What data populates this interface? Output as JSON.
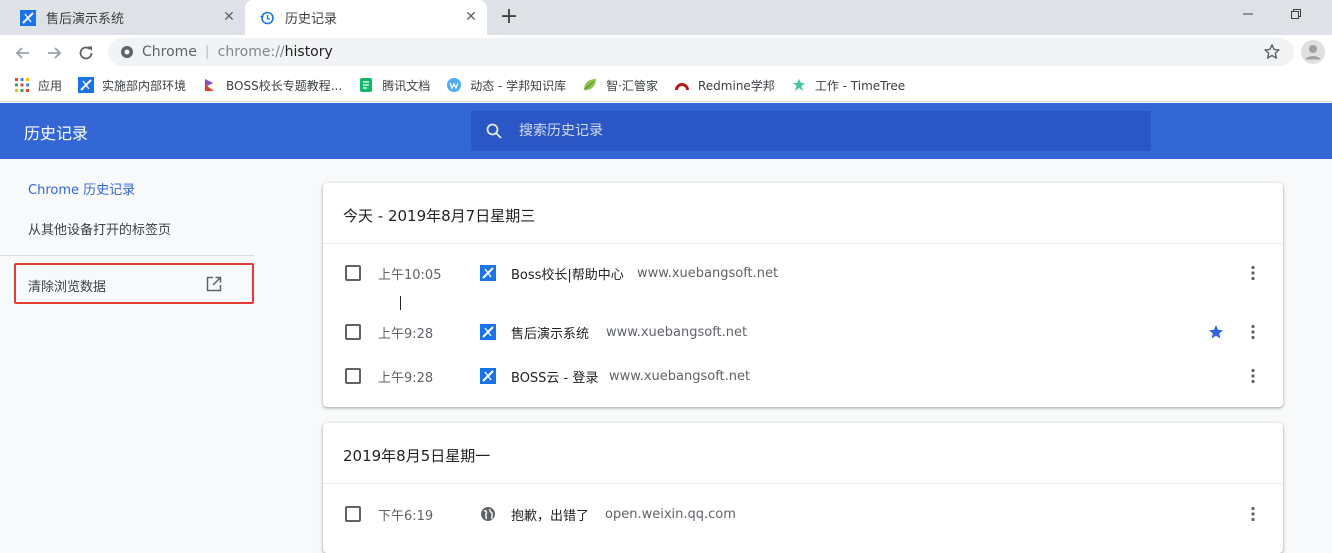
{
  "tabs": [
    {
      "title": "售后演示系统",
      "icon": "x-logo-icon",
      "close": "✕"
    },
    {
      "title": "历史记录",
      "icon": "history-icon",
      "close": "✕"
    }
  ],
  "new_tab_symbol": "+",
  "omnibox": {
    "chip": "Chrome",
    "separator": "|",
    "scheme": "chrome://",
    "path": "history"
  },
  "bookmarks": [
    {
      "label": "应用",
      "icon": "apps-grid-icon"
    },
    {
      "label": "实施部内部环境",
      "icon": "x-logo-icon"
    },
    {
      "label": "BOSS校长专题教程...",
      "icon": "boss-logo-icon"
    },
    {
      "label": "腾讯文档",
      "icon": "tencent-docs-icon"
    },
    {
      "label": "动态 - 学邦知识库",
      "icon": "wiki-icon"
    },
    {
      "label": "智·汇管家",
      "icon": "leaf-icon"
    },
    {
      "label": "Redmine学邦",
      "icon": "redmine-icon"
    },
    {
      "label": "工作 - TimeTree",
      "icon": "timetree-icon"
    }
  ],
  "header": {
    "title": "历史记录",
    "search_placeholder": "搜索历史记录"
  },
  "sidebar": {
    "chrome_history": "Chrome 历史记录",
    "other_devices": "从其他设备打开的标签页",
    "clear_data": "清除浏览数据"
  },
  "groups": [
    {
      "date": "今天 - 2019年8月7日星期三",
      "items": [
        {
          "time": "上午10:05",
          "title": "Boss校长|帮助中心",
          "domain": "www.xuebangsoft.net",
          "icon": "x-logo-icon",
          "starred": false
        },
        {
          "time": "上午9:28",
          "title": "售后演示系统",
          "domain": "www.xuebangsoft.net",
          "icon": "x-logo-icon",
          "starred": true
        },
        {
          "time": "上午9:28",
          "title": "BOSS云 - 登录",
          "domain": "www.xuebangsoft.net",
          "icon": "x-logo-icon",
          "starred": false
        }
      ]
    },
    {
      "date": "2019年8月5日星期一",
      "items": [
        {
          "time": "下午6:19",
          "title": "抱歉，出错了",
          "domain": "open.weixin.qq.com",
          "icon": "globe-icon",
          "starred": false
        }
      ]
    }
  ],
  "colors": {
    "header_blue": "#3367d6",
    "search_blue": "#2a56c6",
    "highlight_red": "#e53935",
    "star_blue": "#3367d6"
  }
}
